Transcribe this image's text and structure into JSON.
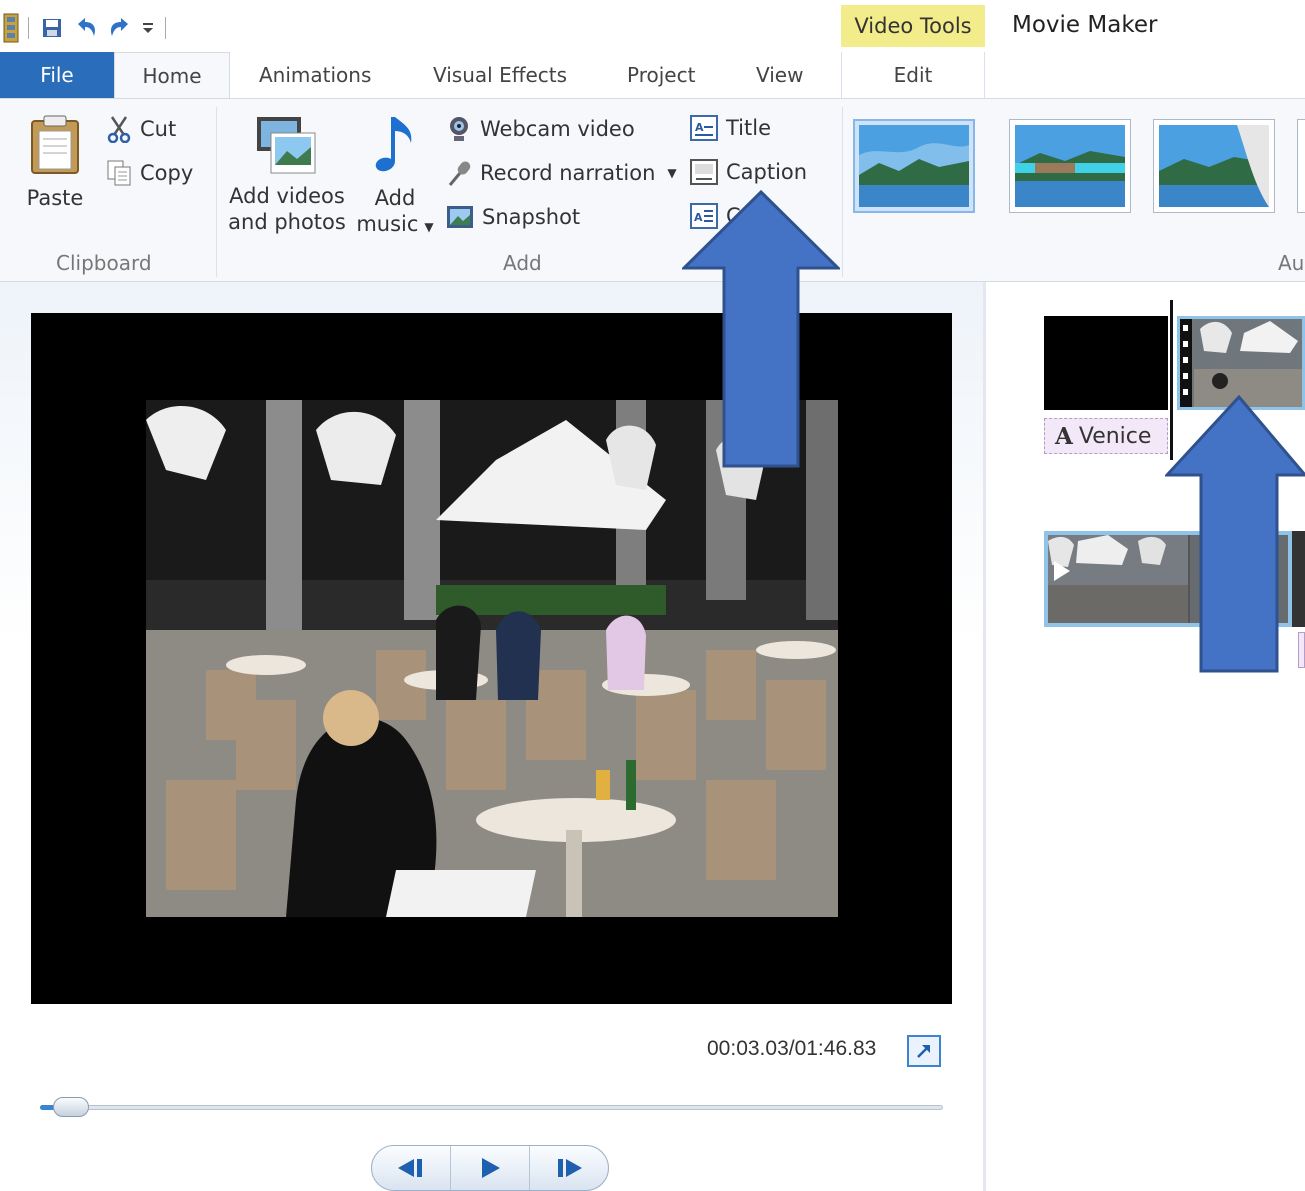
{
  "app": {
    "title": "Movie Maker",
    "contextual_tab_group": "Video Tools"
  },
  "tabs": [
    "File",
    "Home",
    "Animations",
    "Visual Effects",
    "Project",
    "View",
    "Edit"
  ],
  "ribbon": {
    "clipboard": {
      "label": "Clipboard",
      "paste": "Paste",
      "cut": "Cut",
      "copy": "Copy"
    },
    "add": {
      "label": "Add",
      "add_videos_line1": "Add videos",
      "add_videos_line2": "and photos",
      "add_music_line1": "Add",
      "add_music_line2": "music",
      "webcam_video": "Webcam video",
      "record_narration": "Record narration",
      "snapshot": "Snapshot",
      "title": "Title",
      "caption": "Caption",
      "credits": "C      ts"
    },
    "automovie": {
      "label_partial": "Au"
    }
  },
  "preview": {
    "timecode": "00:03.03/01:46.83",
    "seek_position": 0.02
  },
  "storyboard": {
    "caption_text": "Venice"
  },
  "colors": {
    "file_tab": "#2a6ebb",
    "contextual": "#f3ec8a",
    "annotation_arrow": "#4472c4",
    "selection": "#8fc3e8"
  }
}
